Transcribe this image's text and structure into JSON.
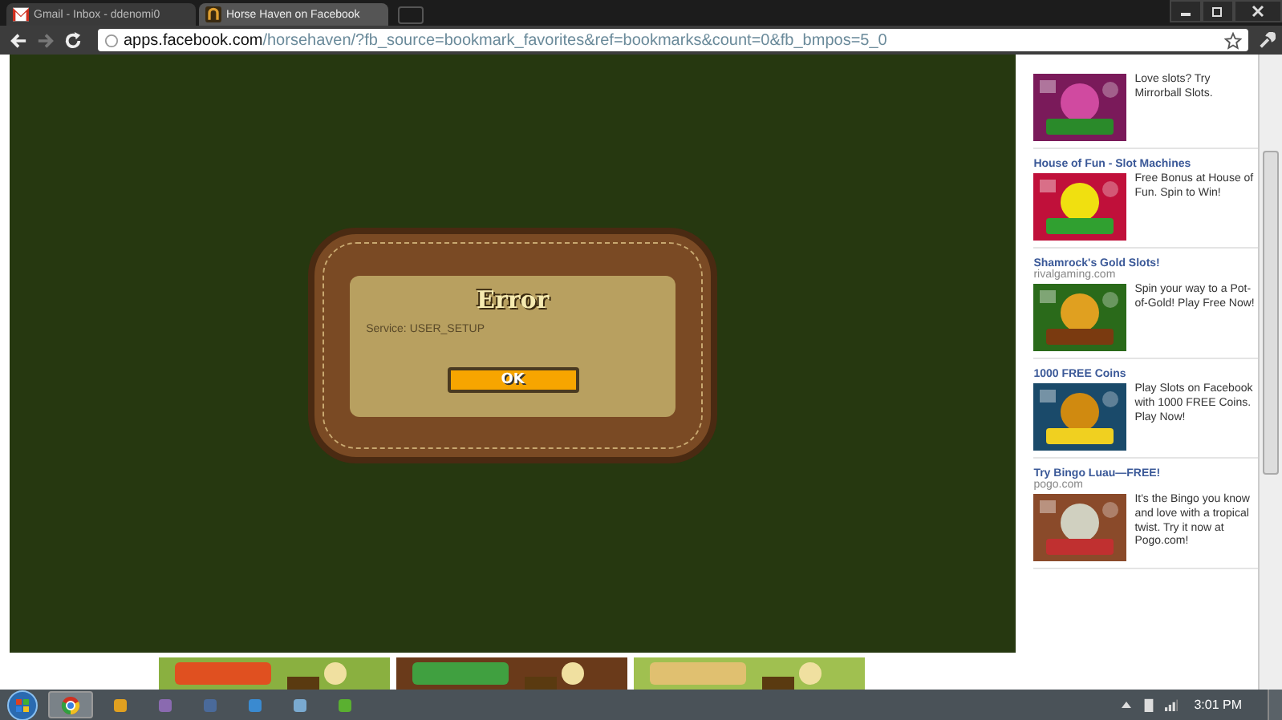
{
  "browser": {
    "tabs": [
      {
        "title": "Gmail - Inbox - ddenomi0",
        "selected": false,
        "kind": "mail"
      },
      {
        "title": "Horse Haven on Facebook",
        "selected": true,
        "kind": "game"
      }
    ],
    "url_host": "apps.facebook.com",
    "url_path": "/horsehaven/?fb_source=bookmark_favorites&ref=bookmarks&count=0&fb_bmpos=5_0"
  },
  "dialog": {
    "title": "Error",
    "message": "Service: USER_SETUP",
    "button": "OK"
  },
  "ads": [
    {
      "kind": "picture",
      "text": "Love slots? Try Mirrorball Slots."
    },
    {
      "kind": "picture",
      "title": "House of Fun - Slot Machines",
      "text": "Free Bonus at House of Fun. Spin to Win!"
    },
    {
      "kind": "picture",
      "title": "Shamrock's Gold Slots!",
      "domain": "rivalgaming.com",
      "text": "Spin your way to a Pot-of-Gold! Play Free Now!"
    },
    {
      "kind": "picture",
      "title": "1000 FREE Coins",
      "text": "Play Slots on Facebook with 1000 FREE Coins. Play Now!"
    },
    {
      "kind": "picture",
      "title": "Try Bingo Luau—FREE!",
      "domain": "pogo.com",
      "text": "It's the Bingo you know and love with a tropical twist. Try it now at Pogo.com!"
    }
  ],
  "taskbar": {
    "clock": "3:01 PM"
  }
}
